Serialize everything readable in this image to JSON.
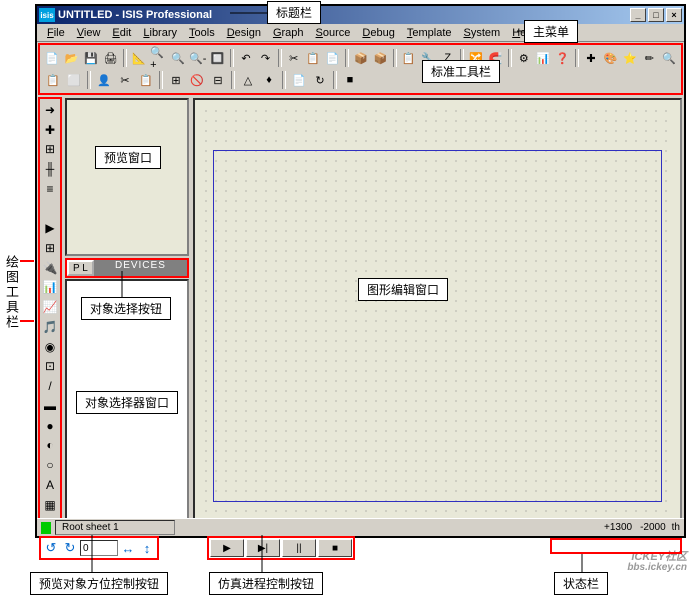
{
  "title_bar": {
    "icon_text": "isis",
    "text": "UNTITLED - ISIS Professional"
  },
  "win_buttons": {
    "min": "_",
    "max": "□",
    "close": "×"
  },
  "menu": [
    "File",
    "View",
    "Edit",
    "Library",
    "Tools",
    "Design",
    "Graph",
    "Source",
    "Debug",
    "Template",
    "System",
    "Help"
  ],
  "toolbar1_icons": [
    "📄",
    "📂",
    "💾",
    "🖨",
    "|",
    "📐",
    "🔍+",
    "🔍",
    "🔍-",
    "🔲",
    "|",
    "↶",
    "↷",
    "|",
    "✂",
    "📋",
    "📄",
    "|",
    "📦",
    "📦",
    "|",
    "📋",
    "🔧",
    "Z",
    "|",
    "🔀",
    "🧲",
    "|",
    "⚙",
    "📊",
    "❓",
    "|",
    "✚",
    "🎨",
    "⭐",
    "✏",
    "🔍"
  ],
  "toolbar2_icons": [
    "📋",
    "⬜",
    "|",
    "👤",
    "✂",
    "📋",
    "|",
    "⊞",
    "🚫",
    "⊟",
    "|",
    "△",
    "♦",
    "|",
    "📄",
    "↻",
    "|",
    "■"
  ],
  "draw_icons": [
    "➜",
    "✚",
    "⊞",
    "╫",
    "≡",
    "",
    "▶",
    "⊞",
    "🔌",
    "📊",
    "📈",
    "🎵",
    "◉",
    "⊡",
    "/",
    "▬",
    "●",
    "◐",
    "○",
    "A",
    "▦",
    "✚"
  ],
  "pick_header": {
    "pl": "P  L",
    "devices": "DEVICES"
  },
  "orient": {
    "rotL": "↺",
    "rotR": "↻",
    "value": "0",
    "flipH": "↔",
    "flipV": "↕"
  },
  "sim": {
    "play": "▶",
    "step": "▶|",
    "pause": "||",
    "stop": "■"
  },
  "status": {
    "sheet": "Root sheet 1",
    "coord1": "+1300",
    "coord2": "-2000",
    "unit": "th"
  },
  "labels": {
    "title": "标题栏",
    "mainmenu": "主菜单",
    "stdtoolbar": "标准工具栏",
    "drawbar": "绘图工具栏",
    "preview": "预览窗口",
    "pickbtn": "对象选择按钮",
    "picker": "对象选择器窗口",
    "editwin": "图形编辑窗口",
    "orient": "预览对象方位控制按钮",
    "sim": "仿真进程控制按钮",
    "status": "状态栏"
  },
  "watermark": {
    "l1": "ICKEY社区",
    "l2": "bbs.ickey.cn"
  }
}
